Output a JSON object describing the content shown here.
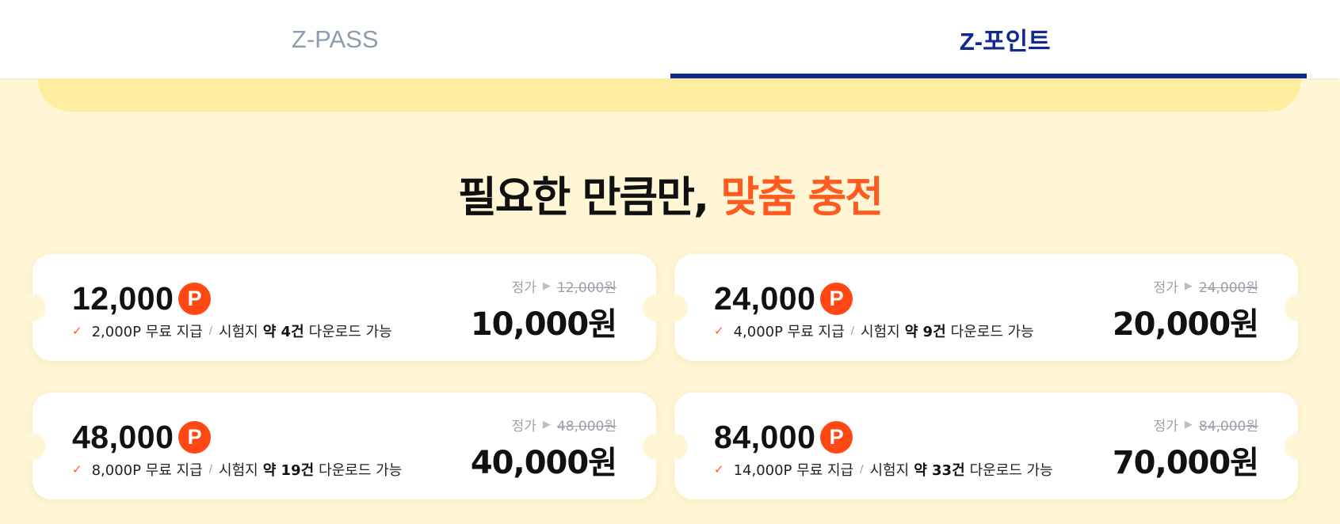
{
  "tabs": [
    {
      "label": "Z-PASS",
      "active": false
    },
    {
      "label": "Z-포인트",
      "active": true
    }
  ],
  "headline": {
    "text": "필요한 만큼만,",
    "accent": "맞춤 충전"
  },
  "accent_color": "#ff5a1f",
  "active_tab_color": "#10298f",
  "point_badge": "P",
  "products": [
    {
      "points": "12,000",
      "bonus": "2,000P 무료 지급",
      "sep": "/",
      "doc_prefix": "시험지",
      "doc_count": "약 4건",
      "doc_suffix": "다운로드 가능",
      "orig_label": "정가",
      "orig_price": "12,000원",
      "price": "10,000원"
    },
    {
      "points": "24,000",
      "bonus": "4,000P 무료 지급",
      "sep": "/",
      "doc_prefix": "시험지",
      "doc_count": "약 9건",
      "doc_suffix": "다운로드 가능",
      "orig_label": "정가",
      "orig_price": "24,000원",
      "price": "20,000원"
    },
    {
      "points": "48,000",
      "bonus": "8,000P 무료 지급",
      "sep": "/",
      "doc_prefix": "시험지",
      "doc_count": "약 19건",
      "doc_suffix": "다운로드 가능",
      "orig_label": "정가",
      "orig_price": "48,000원",
      "price": "40,000원"
    },
    {
      "points": "84,000",
      "bonus": "14,000P 무료 지급",
      "sep": "/",
      "doc_prefix": "시험지",
      "doc_count": "약 33건",
      "doc_suffix": "다운로드 가능",
      "orig_label": "정가",
      "orig_price": "84,000원",
      "price": "70,000원"
    }
  ]
}
